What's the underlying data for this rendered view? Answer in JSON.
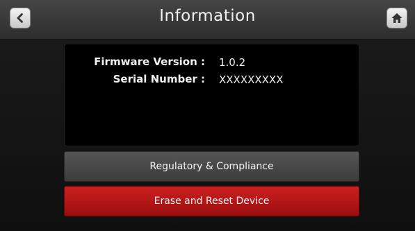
{
  "header": {
    "title": "Information",
    "back_icon": "chevron-left-icon",
    "home_icon": "home-icon"
  },
  "info": {
    "firmware_label": "Firmware Version :",
    "firmware_value": "1.0.2",
    "serial_label": "Serial Number :",
    "serial_value": "XXXXXXXXX"
  },
  "actions": {
    "regulatory_label": "Regulatory & Compliance",
    "erase_label": "Erase and Reset Device"
  },
  "colors": {
    "danger": "#b31515",
    "neutral_button": "#484848",
    "panel": "#000000"
  }
}
